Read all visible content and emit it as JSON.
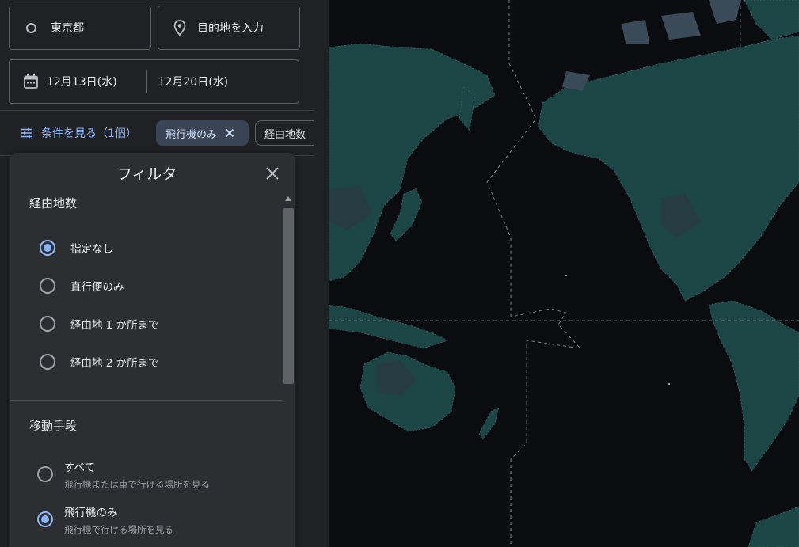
{
  "search": {
    "origin": "東京都",
    "destination_placeholder": "目的地を入力",
    "depart_date": "12月13日(水)",
    "return_date": "12月20日(水)"
  },
  "filters_bar": {
    "toggle_label": "条件を見る（1個）",
    "chips": [
      "飛行機のみ",
      "経由地数"
    ]
  },
  "dialog": {
    "title": "フィルタ",
    "stops": {
      "title": "経由地数",
      "options": [
        "指定なし",
        "直行便のみ",
        "経由地 1 か所まで",
        "経由地 2 か所まで"
      ],
      "selected_index": 0
    },
    "transport": {
      "title": "移動手段",
      "options": [
        {
          "label": "すべて",
          "sub": "飛行機または車で行ける場所を見る"
        },
        {
          "label": "飛行機のみ",
          "sub": "飛行機で行ける場所を見る"
        }
      ],
      "selected_index": 1
    }
  },
  "colors": {
    "accent": "#8ab4f8",
    "panel_bg": "#202124",
    "dialog_bg": "#2d2e31",
    "land": "#1b4a4a",
    "ocean": "#0b0c10"
  },
  "icons": [
    "origin-circle-icon",
    "pin-icon",
    "calendar-icon",
    "tune-icon",
    "close-icon",
    "chevron-up-icon"
  ]
}
